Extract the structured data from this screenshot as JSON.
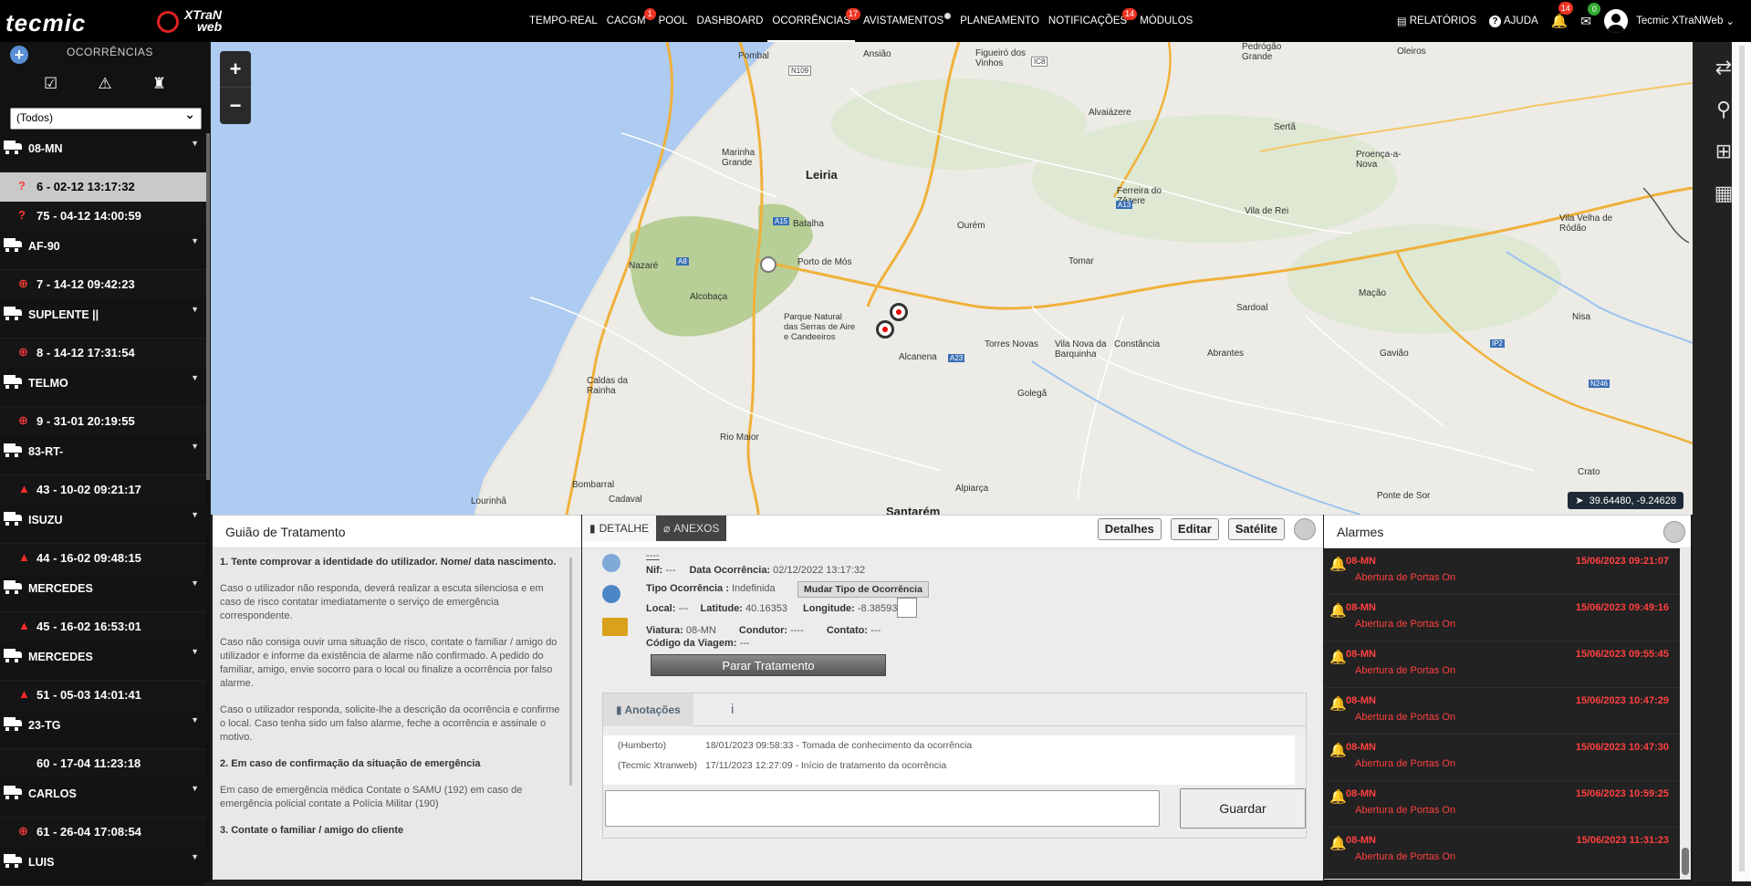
{
  "header": {
    "logo_left": "tecmic",
    "logo_right_line1": "XTraN",
    "logo_right_line2": "web",
    "nav": [
      {
        "label": "TEMPO-REAL",
        "badge": ""
      },
      {
        "label": "CACGM",
        "badge": "1"
      },
      {
        "label": "POOL",
        "badge": ""
      },
      {
        "label": "DASHBOARD",
        "badge": ""
      },
      {
        "label": "OCORRÊNCIAS",
        "badge": "17"
      },
      {
        "label": "AVISTAMENTOS",
        "badge": ""
      },
      {
        "label": "PLANEAMENTO",
        "badge": ""
      },
      {
        "label": "NOTIFICAÇÕES",
        "badge": "14"
      },
      {
        "label": "MÓDULOS",
        "badge": ""
      }
    ],
    "relatorios": "RELATÓRIOS",
    "ajuda": "AJUDA",
    "bell_count": "14",
    "mail_count": "0",
    "user": "Tecmic XTraNWeb"
  },
  "sidebar": {
    "title": "OCORRÊNCIAS",
    "filter_value": "(Todos)",
    "groups": [
      {
        "vehicle": "08-MN",
        "occurrences": [
          {
            "text": "6 - 02-12 13:17:32",
            "icon": "question",
            "selected": true
          },
          {
            "text": "75 - 04-12 14:00:59",
            "icon": "question",
            "selected": false
          }
        ]
      },
      {
        "vehicle": "AF-90",
        "occurrences": [
          {
            "text": "7 - 14-12 09:42:23",
            "icon": "target"
          }
        ]
      },
      {
        "vehicle": "SUPLENTE ||",
        "occurrences": [
          {
            "text": "8 - 14-12 17:31:54",
            "icon": "target"
          }
        ]
      },
      {
        "vehicle": "TELMO",
        "occurrences": [
          {
            "text": "9 - 31-01 20:19:55",
            "icon": "target"
          }
        ]
      },
      {
        "vehicle": "83-RT-",
        "occurrences": [
          {
            "text": "43 - 10-02 09:21:17",
            "icon": "warning"
          }
        ]
      },
      {
        "vehicle": "ISUZU",
        "occurrences": [
          {
            "text": "44 - 16-02 09:48:15",
            "icon": "warning"
          }
        ]
      },
      {
        "vehicle": "MERCEDES",
        "occurrences": [
          {
            "text": "45 - 16-02 16:53:01",
            "icon": "warning"
          }
        ]
      },
      {
        "vehicle": "MERCEDES",
        "occurrences": [
          {
            "text": "51 - 05-03 14:01:41",
            "icon": "warning"
          }
        ]
      },
      {
        "vehicle": "23-TG",
        "occurrences": [
          {
            "text": "60 - 17-04 11:23:18",
            "icon": "none"
          }
        ]
      },
      {
        "vehicle": "CARLOS",
        "occurrences": [
          {
            "text": "61 - 26-04 17:08:54",
            "icon": "target"
          }
        ]
      },
      {
        "vehicle": "LUIS",
        "occurrences": []
      }
    ]
  },
  "map": {
    "coords": "39.64480, -9.24628",
    "labels": [
      "Pombal",
      "Ansião",
      "Figueiró dos Vinhos",
      "Pedrógão Grande",
      "Oleiros",
      "Marinha Grande",
      "Leiria",
      "Alvaiázere",
      "Sertã",
      "Proença-a-Nova",
      "Batalha",
      "Ferreira do Zêzere",
      "Vila de Rei",
      "Vila Velha de Ródão",
      "Nazaré",
      "Porto de Mós",
      "Ourém",
      "Tomar",
      "Alcobaça",
      "Parque Natural das Serras de Aire e Candeeiros",
      "Mação",
      "Sardoal",
      "Torres Novas",
      "Vila Nova da Barquinha",
      "Constância",
      "Abrantes",
      "Gavião",
      "Nisa",
      "Caldas da Rainha",
      "Alcanena",
      "Golegã",
      "Rio Maior",
      "Bombarral",
      "Cadaval",
      "Lourinhã",
      "Alpiarça",
      "Santarém",
      "Ponte de Sor",
      "Crato"
    ],
    "road_labels": [
      "N109",
      "IC8",
      "A15",
      "A8",
      "A13",
      "A23",
      "IP2",
      "N246"
    ]
  },
  "guide": {
    "title": "Guião de Tratamento",
    "h1": "1. Tente comprovar a identidade do utilizador. Nome/ data nascimento.",
    "p1": "Caso o utilizador não responda, deverá realizar a escuta silenciosa e em caso de risco contatar imediatamente o serviço de emergência correspondente.",
    "p2": "Caso não consiga ouvir uma situação de risco, contate o familiar / amigo do utilizador e informe da existência de alarme não confirmado. A pedido do familiar, amigo, envie socorro para o local ou finalize a ocorrência por falso alarme.",
    "p3": "Caso o utilizador responda, solicite-lhe a descrição da ocorrência e confirme o local. Caso tenha sido um falso alarme, feche a ocorrência e assinale o motivo.",
    "h2": "2. Em caso de confirmação da situação de emergência",
    "p4": "Em caso de emergência médica Contate o SAMU (192) em caso de emergência policial contate a Polícia Militar (190)",
    "h3": "3. Contate o familiar / amigo do cliente"
  },
  "detail": {
    "tab_detalhe": "DETALHE",
    "tab_anexos": "ANEXOS",
    "btn_detalhes": "Detalhes",
    "btn_editar": "Editar",
    "btn_satelite": "Satélite",
    "name": "----",
    "nif_label": "Nif:",
    "nif_value": "---",
    "data_label": "Data Ocorrência:",
    "data_value": "02/12/2022 13:17:32",
    "tipo_label": "Tipo Ocorrência :",
    "tipo_value": "Indefinida",
    "mudar": "Mudar Tipo de Ocorrência",
    "local_label": "Local:",
    "local_value": "---",
    "lat_label": "Latitude:",
    "lat_value": "40.16353",
    "lon_label": "Longitude:",
    "lon_value": "-8.38593",
    "viatura_label": "Viatura:",
    "viatura_value": "08-MN",
    "condutor_label": "Condutor:",
    "condutor_value": "----",
    "contato_label": "Contato:",
    "contato_value": "---",
    "viagem_label": "Código da Viagem:",
    "viagem_value": "---",
    "parar": "Parar Tratamento",
    "notes_tab": "Anotações",
    "info_tab": "i",
    "notes": [
      {
        "who": "(Humberto)",
        "text": "18/01/2023 09:58:33 - Tomada de conhecimento da ocorrência"
      },
      {
        "who": "(Tecmic Xtranweb)",
        "text": "17/11/2023 12:27:09 - Início de tratamento da ocorrência"
      }
    ],
    "guardar": "Guardar"
  },
  "alarms": {
    "title": "Alarmes",
    "items": [
      {
        "vehicle": "08-MN",
        "date": "15/06/2023 09:21:07",
        "desc": "Abertura de Portas On"
      },
      {
        "vehicle": "08-MN",
        "date": "15/06/2023 09:49:16",
        "desc": "Abertura de Portas On"
      },
      {
        "vehicle": "08-MN",
        "date": "15/06/2023 09:55:45",
        "desc": "Abertura de Portas On"
      },
      {
        "vehicle": "08-MN",
        "date": "15/06/2023 10:47:29",
        "desc": "Abertura de Portas On"
      },
      {
        "vehicle": "08-MN",
        "date": "15/06/2023 10:47:30",
        "desc": "Abertura de Portas On"
      },
      {
        "vehicle": "08-MN",
        "date": "15/06/2023 10:59:25",
        "desc": "Abertura de Portas On"
      },
      {
        "vehicle": "08-MN",
        "date": "15/06/2023 11:31:23",
        "desc": "Abertura de Portas On"
      }
    ]
  },
  "colors": {
    "accent_red": "#e33333",
    "topbar": "#000000",
    "sidebar": "#131313"
  }
}
